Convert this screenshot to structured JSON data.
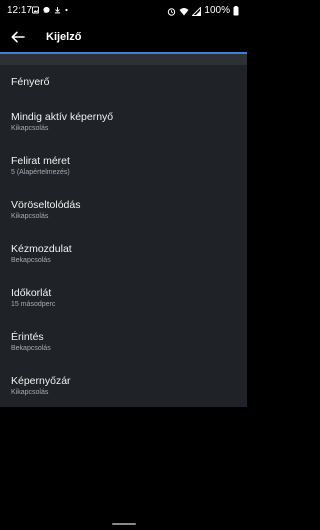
{
  "status_bar": {
    "time": "12:17",
    "battery": "100%",
    "left_icons": [
      "image-icon",
      "messenger-icon",
      "download-icon",
      "dot-icon"
    ],
    "right_icons": [
      "alarm-icon",
      "wifi-icon",
      "signal-icon",
      "battery-icon"
    ]
  },
  "header": {
    "back_icon": "arrow-left-icon",
    "title": "Kijelző",
    "accent_color": "#3f7fd6"
  },
  "settings": {
    "items": [
      {
        "title": "Fényerő",
        "subtitle": ""
      },
      {
        "title": "Mindig aktív képernyő",
        "subtitle": "Kikapcsolás"
      },
      {
        "title": "Felirat méret",
        "subtitle": "5 (Alapértelmezés)"
      },
      {
        "title": "Vöröseltolódás",
        "subtitle": "Kikapcsolás"
      },
      {
        "title": "Kézmozdulat",
        "subtitle": "Bekapcsolás"
      },
      {
        "title": "Időkorlát",
        "subtitle": "15 másodperc"
      },
      {
        "title": "Érintés",
        "subtitle": "Bekapcsolás"
      },
      {
        "title": "Képernyőzár",
        "subtitle": "Kikapcsolás"
      }
    ]
  }
}
